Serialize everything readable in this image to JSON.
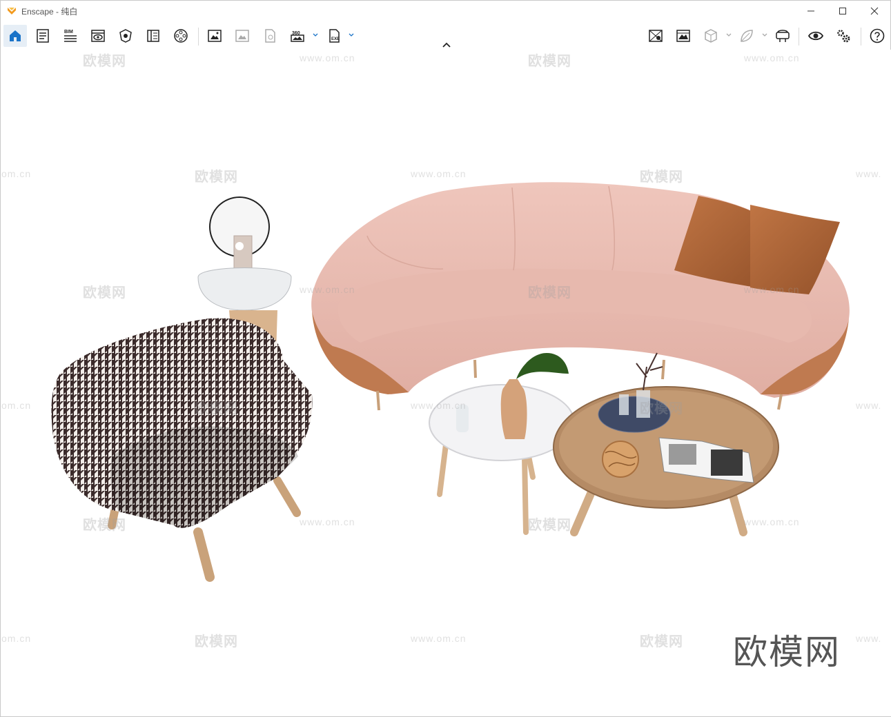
{
  "window": {
    "app_name": "Enscape",
    "separator": " - ",
    "document": "纯白"
  },
  "toolbar": {
    "bim_label": "BIM",
    "pano_label": "360",
    "exe_label": "EXE"
  },
  "watermarks": {
    "logo_text": "欧模网",
    "url_text": "www.om.cn",
    "url_cut_left": "om.cn",
    "url_cut_right": "www."
  },
  "brand_text": "欧模网",
  "colors": {
    "accent": "#1a73c8",
    "sofa": "#e9bdb2",
    "sofa_leather": "#b8734a",
    "pillow": "#b16434",
    "wood": "#c8a07a",
    "white_table": "#f2f2f3"
  }
}
